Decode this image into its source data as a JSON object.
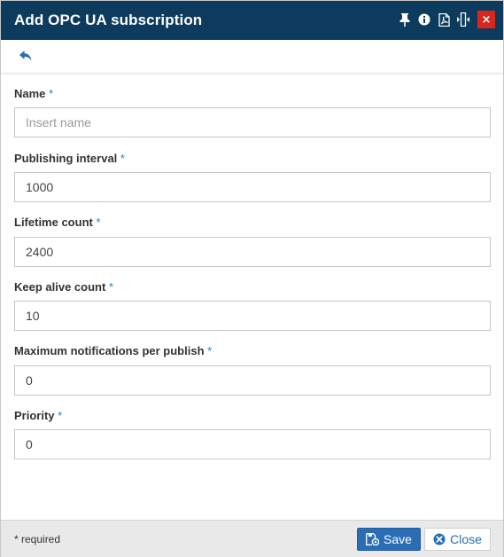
{
  "dialog": {
    "title": "Add OPC UA subscription",
    "title_icons": [
      "pin-icon",
      "info-icon",
      "pdf-icon",
      "resize-width-icon"
    ],
    "close_glyph": "×",
    "colors": {
      "titlebar": "#0d3b5e",
      "close_button": "#d9261c",
      "accent": "#2a6db5",
      "required_star": "#2a7fc0"
    }
  },
  "toolbar": {
    "back_icon": "reply-arrow-icon"
  },
  "fields": [
    {
      "label": "Name",
      "required_mark": "*",
      "value": "",
      "placeholder": "Insert name"
    },
    {
      "label": "Publishing interval",
      "required_mark": "*",
      "value": "1000",
      "placeholder": ""
    },
    {
      "label": "Lifetime count",
      "required_mark": "*",
      "value": "2400",
      "placeholder": ""
    },
    {
      "label": "Keep alive count",
      "required_mark": "*",
      "value": "10",
      "placeholder": ""
    },
    {
      "label": "Maximum notifications per publish",
      "required_mark": "*",
      "value": "0",
      "placeholder": ""
    },
    {
      "label": "Priority",
      "required_mark": "*",
      "value": "0",
      "placeholder": ""
    }
  ],
  "footer": {
    "required_note": "* required",
    "save_label": "Save",
    "close_label": "Close"
  }
}
